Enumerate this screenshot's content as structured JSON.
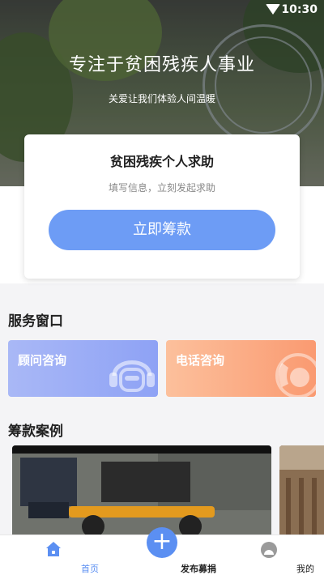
{
  "status_bar": {
    "time": "10:30"
  },
  "hero": {
    "title": "专注于贫困残疾人事业",
    "subtitle": "关爱让我们体验人间温暖"
  },
  "help_card": {
    "title": "贫困残疾个人求助",
    "subtitle": "填写信息，立刻发起求助",
    "button_label": "立即筹款"
  },
  "services": {
    "title": "服务窗口",
    "items": [
      {
        "label": "顾问咨询",
        "icon": "headset-icon",
        "color": "#9aabf5"
      },
      {
        "label": "电话咨询",
        "icon": "phone-icon",
        "color": "#fba67d"
      }
    ]
  },
  "cases": {
    "title": "筹款案例"
  },
  "bottom_nav": {
    "items": [
      {
        "label": "首页",
        "icon": "home-icon",
        "active": true
      },
      {
        "label": "发布募捐",
        "icon": "plus-icon"
      },
      {
        "label": "我的",
        "icon": "profile-icon"
      }
    ]
  },
  "colors": {
    "accent": "#5b8ff2",
    "button": "#6d9cf5"
  }
}
